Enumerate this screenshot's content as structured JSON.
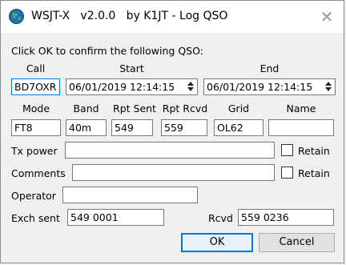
{
  "window": {
    "title": "WSJT-X   v2.0.0   by K1JT - Log QSO",
    "close_glyph": "✕"
  },
  "prompt": "Click OK to confirm the following QSO:",
  "headers": {
    "call": "Call",
    "start": "Start",
    "end": "End",
    "mode": "Mode",
    "band": "Band",
    "rpt_sent": "Rpt Sent",
    "rpt_rcvd": "Rpt Rcvd",
    "grid": "Grid",
    "name": "Name"
  },
  "values": {
    "call": "BD7OXR",
    "start": "06/01/2019 12:14:15",
    "end": "06/01/2019 12:14:15",
    "mode": "FT8",
    "band": "40m",
    "rpt_sent": "549",
    "rpt_rcvd": "559",
    "grid": "OL62",
    "name": "",
    "tx_power": "",
    "comments": "",
    "operator": "",
    "exch_sent": "549 0001",
    "rcvd": "559 0236"
  },
  "labels": {
    "tx_power": "Tx power",
    "comments": "Comments",
    "operator": "Operator",
    "exch_sent": "Exch sent",
    "rcvd": "Rcvd",
    "retain": "Retain"
  },
  "retain": {
    "tx_power_checked": false,
    "comments_checked": false
  },
  "buttons": {
    "ok": "OK",
    "cancel": "Cancel"
  },
  "colors": {
    "focus_accent": "#0078d7",
    "dialog_bg": "#f0f0f0"
  }
}
